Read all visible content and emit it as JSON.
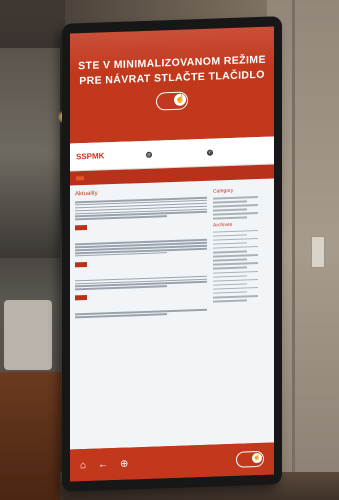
{
  "kiosk": {
    "banner_line1": "STE V MINIMALIZOVANOM REŽIME",
    "banner_line2": "PRE NÁVRAT STLAČTE TLAČIDLO",
    "touch_icon": "hand-touch-icon"
  },
  "website": {
    "logo": "SSPMK",
    "section_title": "Aktuality",
    "sidebar_category_title": "Category",
    "sidebar_archives_title": "Archives"
  },
  "colors": {
    "kiosk_accent": "#c2381d",
    "site_background": "#f2f5f8"
  },
  "bottom_bar": {
    "icons": [
      "home-icon",
      "back-arrow-icon",
      "zoom-icon"
    ]
  }
}
